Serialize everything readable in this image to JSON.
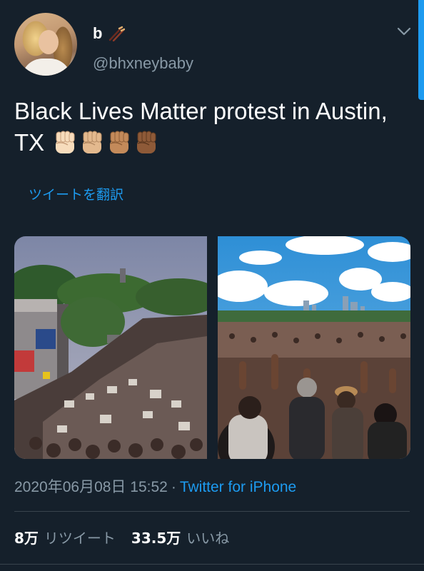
{
  "user": {
    "display_name": "b",
    "handle": "@bhxneybaby",
    "name_emoji": "chopsticks-icon"
  },
  "tweet": {
    "text": "Black Lives Matter protest in Austin, TX",
    "emojis": [
      "raised-fist-light-icon",
      "raised-fist-medium-light-icon",
      "raised-fist-medium-icon",
      "raised-fist-medium-dark-icon"
    ],
    "translate_label": "ツイートを翻訳"
  },
  "media": {
    "photos": [
      "protest-street-photo",
      "protest-crowd-photo"
    ]
  },
  "meta": {
    "timestamp": "2020年06月08日 15:52",
    "separator": "·",
    "source": "Twitter for iPhone"
  },
  "stats": {
    "retweets_count": "8万",
    "retweets_label": "リツイート",
    "likes_count": "33.5万",
    "likes_label": "いいね"
  },
  "colors": {
    "background": "#15202b",
    "accent": "#1d9bf0",
    "secondary_text": "#8899a6",
    "divider": "#38444d"
  }
}
